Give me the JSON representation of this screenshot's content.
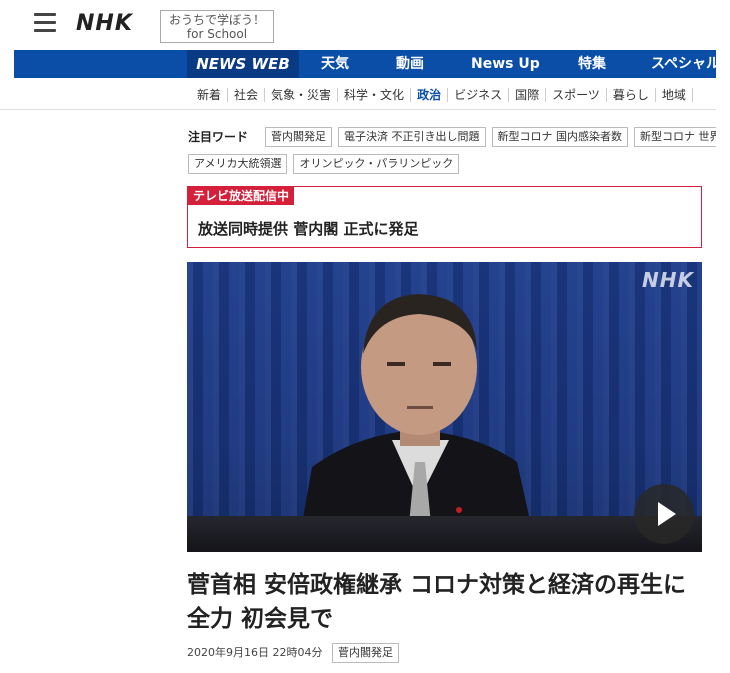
{
  "header": {
    "logo": "NHK",
    "school_line1": "おうちで学ぼう！",
    "school_line2": "for School"
  },
  "main_nav": [
    "NEWS WEB",
    "天気",
    "動画",
    "News Up",
    "特集",
    "スペシャル"
  ],
  "sub_nav": {
    "items": [
      "新着",
      "社会",
      "気象・災害",
      "科学・文化",
      "政治",
      "ビジネス",
      "国際",
      "スポーツ",
      "暮らし",
      "地域"
    ],
    "active": "政治"
  },
  "keywords": {
    "label": "注目ワード",
    "row1": [
      "菅内閣発足",
      "電子決済 不正引き出し問題",
      "新型コロナ 国内感染者数",
      "新型コロナ 世界"
    ],
    "row2": [
      "アメリカ大統領選",
      "オリンピック・パラリンピック"
    ]
  },
  "live": {
    "badge": "テレビ放送配信中",
    "title": "放送同時提供 菅内閣 正式に発足"
  },
  "video": {
    "watermark": "NHK"
  },
  "article": {
    "headline": "菅首相 安倍政権継承 コロナ対策と経済の再生に全力 初会見で",
    "date": "2020年9月16日 22時04分",
    "tag": "菅内閣発足"
  },
  "colors": {
    "nav_blue": "#0a4ea8",
    "live_red": "#d4203a"
  }
}
